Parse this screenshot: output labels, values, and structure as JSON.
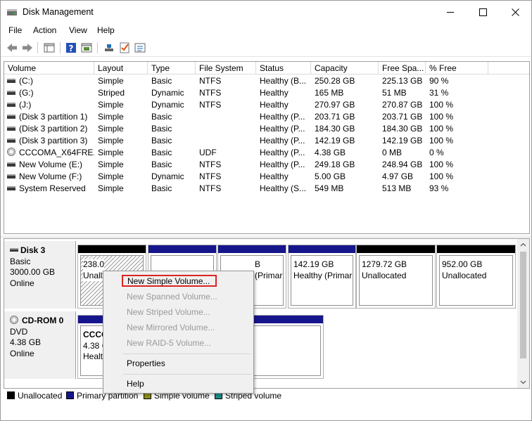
{
  "window": {
    "title": "Disk Management",
    "controls": [
      "minimize",
      "maximize",
      "close"
    ]
  },
  "menu": [
    "File",
    "Action",
    "View",
    "Help"
  ],
  "toolbar": [
    "back-icon",
    "forward-icon",
    "console-tree-icon",
    "help-icon",
    "properties-icon",
    "connect-icon",
    "checklist-icon",
    "list-view-icon"
  ],
  "volume_list": {
    "columns": [
      "Volume",
      "Layout",
      "Type",
      "File System",
      "Status",
      "Capacity",
      "Free Spa...",
      "% Free"
    ],
    "rows": [
      {
        "volume": "(C:)",
        "layout": "Simple",
        "type": "Basic",
        "fs": "NTFS",
        "status": "Healthy (B...",
        "capacity": "250.28 GB",
        "free": "225.13 GB",
        "pct": "90 %",
        "icon": "volume-icon"
      },
      {
        "volume": "(G:)",
        "layout": "Striped",
        "type": "Dynamic",
        "fs": "NTFS",
        "status": "Healthy",
        "capacity": "165 MB",
        "free": "51 MB",
        "pct": "31 %",
        "icon": "volume-icon"
      },
      {
        "volume": "(J:)",
        "layout": "Simple",
        "type": "Dynamic",
        "fs": "NTFS",
        "status": "Healthy",
        "capacity": "270.97 GB",
        "free": "270.87 GB",
        "pct": "100 %",
        "icon": "volume-icon"
      },
      {
        "volume": "(Disk 3 partition 1)",
        "layout": "Simple",
        "type": "Basic",
        "fs": "",
        "status": "Healthy (P...",
        "capacity": "203.71 GB",
        "free": "203.71 GB",
        "pct": "100 %",
        "icon": "volume-icon"
      },
      {
        "volume": "(Disk 3 partition 2)",
        "layout": "Simple",
        "type": "Basic",
        "fs": "",
        "status": "Healthy (P...",
        "capacity": "184.30 GB",
        "free": "184.30 GB",
        "pct": "100 %",
        "icon": "volume-icon"
      },
      {
        "volume": "(Disk 3 partition 3)",
        "layout": "Simple",
        "type": "Basic",
        "fs": "",
        "status": "Healthy (P...",
        "capacity": "142.19 GB",
        "free": "142.19 GB",
        "pct": "100 %",
        "icon": "volume-icon"
      },
      {
        "volume": "CCCOMA_X64FRE...",
        "layout": "Simple",
        "type": "Basic",
        "fs": "UDF",
        "status": "Healthy (P...",
        "capacity": "4.38 GB",
        "free": "0 MB",
        "pct": "0 %",
        "icon": "cd-icon"
      },
      {
        "volume": "New Volume (E:)",
        "layout": "Simple",
        "type": "Basic",
        "fs": "NTFS",
        "status": "Healthy (P...",
        "capacity": "249.18 GB",
        "free": "248.94 GB",
        "pct": "100 %",
        "icon": "volume-icon"
      },
      {
        "volume": "New Volume (F:)",
        "layout": "Simple",
        "type": "Dynamic",
        "fs": "NTFS",
        "status": "Healthy",
        "capacity": "5.00 GB",
        "free": "4.97 GB",
        "pct": "100 %",
        "icon": "volume-icon"
      },
      {
        "volume": "System Reserved",
        "layout": "Simple",
        "type": "Basic",
        "fs": "NTFS",
        "status": "Healthy (S...",
        "capacity": "549 MB",
        "free": "513 MB",
        "pct": "93 %",
        "icon": "volume-icon"
      }
    ]
  },
  "disks": [
    {
      "name": "Disk 3",
      "type": "Basic",
      "size": "3000.00 GB",
      "state": "Online",
      "partitions": [
        {
          "line1": "238.0",
          "line2": "Unall",
          "style": "hatched",
          "bar": "#000000"
        },
        {
          "line1": "",
          "line2": "",
          "style": "plain",
          "bar": "#16168c"
        },
        {
          "line1": "B",
          "line2": "(Primar",
          "style": "plain",
          "bar": "#16168c"
        },
        {
          "line1": "142.19 GB",
          "line2": "Healthy (Primar",
          "style": "plain",
          "bar": "#16168c"
        },
        {
          "line1": "1279.72 GB",
          "line2": "Unallocated",
          "style": "plain",
          "bar": "#000000"
        },
        {
          "line1": "952.00 GB",
          "line2": "Unallocated",
          "style": "plain",
          "bar": "#000000"
        }
      ]
    },
    {
      "name": "CD-ROM 0",
      "type": "DVD",
      "size": "4.38 GB",
      "state": "Online",
      "partitions": [
        {
          "line0": "CCCO",
          "line1": "4.38 G",
          "line2": "Healt",
          "style": "plain",
          "bar": "#16168c"
        }
      ]
    }
  ],
  "legend": [
    {
      "label": "Unallocated",
      "color": "#000000"
    },
    {
      "label": "Primary partition",
      "color": "#16168c"
    },
    {
      "label": "Simple volume",
      "color": "#8c8c1a"
    },
    {
      "label": "Striped volume",
      "color": "#1a8c8c"
    }
  ],
  "context_menu": [
    {
      "label": "New Simple Volume...",
      "enabled": true,
      "highlighted": true
    },
    {
      "label": "New Spanned Volume...",
      "enabled": false
    },
    {
      "label": "New Striped Volume...",
      "enabled": false
    },
    {
      "label": "New Mirrored Volume...",
      "enabled": false
    },
    {
      "label": "New RAID-5 Volume...",
      "enabled": false
    },
    {
      "label": "Properties",
      "enabled": true
    },
    {
      "label": "Help",
      "enabled": true
    }
  ]
}
